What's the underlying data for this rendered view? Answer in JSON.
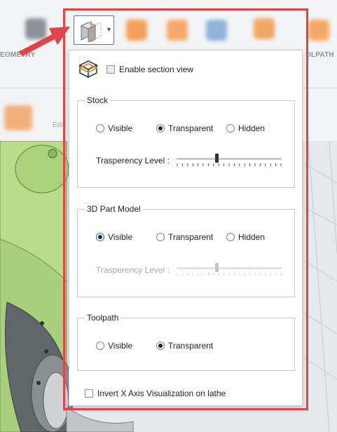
{
  "ribbon": {
    "geometry_label": "EOMETRY",
    "toolpath_label": "OLPATH"
  },
  "toolbar2": {
    "edit_label": "Edi"
  },
  "panel": {
    "enable_section_view": {
      "label": "Enable section view",
      "checked": false
    },
    "stock": {
      "title": "Stock",
      "options": [
        "Visible",
        "Transparent",
        "Hidden"
      ],
      "selected": "Transparent",
      "transparency_label": "Trasperency Level :",
      "transparency_level": 0.38
    },
    "part_model": {
      "title": "3D Part Model",
      "options": [
        "Visible",
        "Transparent",
        "Hidden"
      ],
      "selected": "Visible",
      "transparency_label": "Trasperency Level :",
      "transparency_level": 0.38,
      "transparency_enabled": false
    },
    "toolpath": {
      "title": "Toolpath",
      "options": [
        "Visible",
        "Transparent"
      ],
      "selected": "Transparent"
    },
    "invert_x_axis": {
      "label": "Invert X Axis Visualization on lathe",
      "checked": false
    }
  },
  "colors": {
    "highlight": "#e04448",
    "accent_orange": "#f08a2c",
    "part_green": "#b7dd8a"
  },
  "icons": {
    "dropdown_button": "section-cube-icon",
    "section_view": "section-box-icon",
    "pointer": "red-arrow-icon"
  }
}
